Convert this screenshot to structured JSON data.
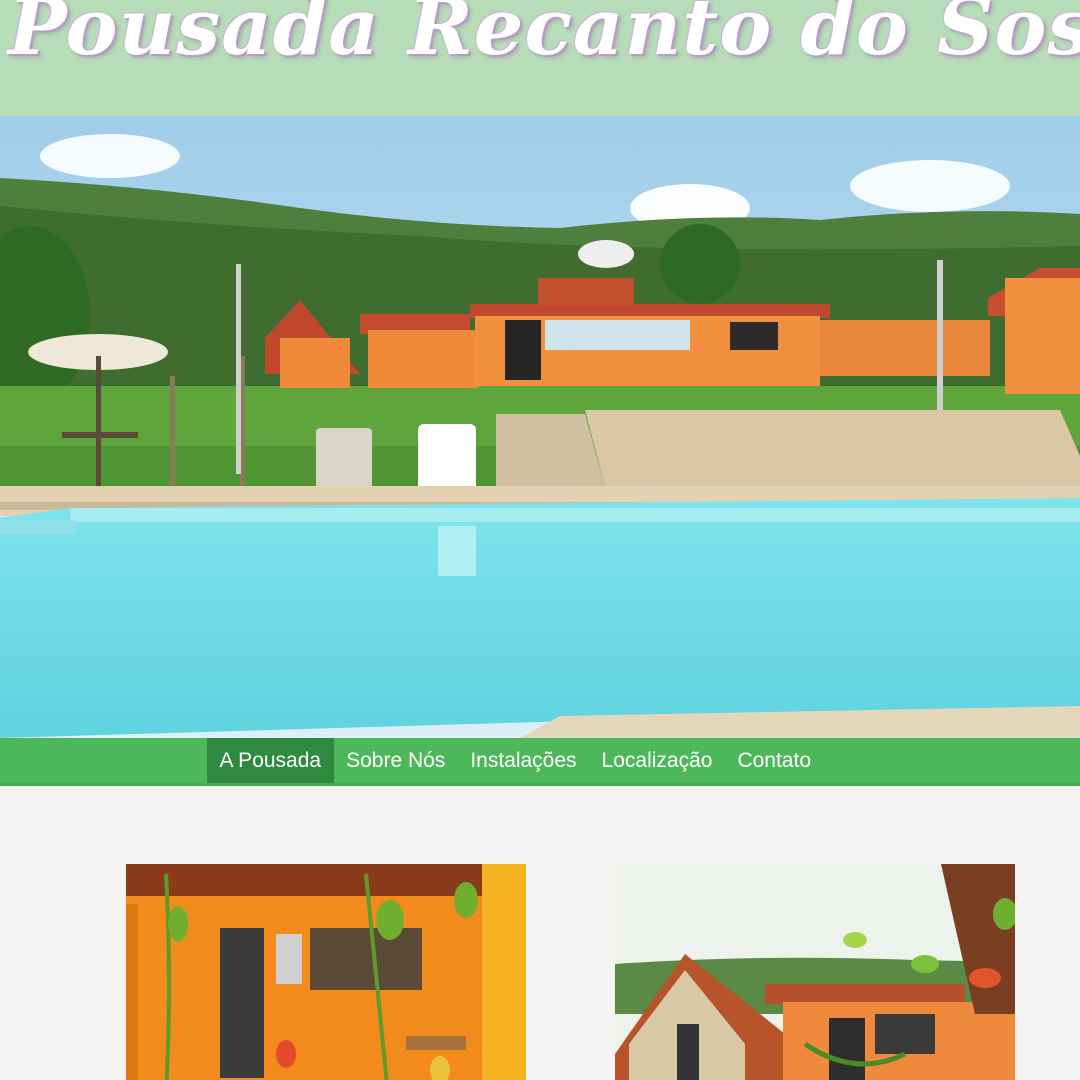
{
  "site": {
    "title": "Pousada Recanto do Sossego"
  },
  "nav": {
    "items": [
      {
        "label": "A Pousada",
        "active": true
      },
      {
        "label": "Sobre Nós",
        "active": false
      },
      {
        "label": "Instalações",
        "active": false
      },
      {
        "label": "Localização",
        "active": false
      },
      {
        "label": "Contato",
        "active": false
      }
    ]
  },
  "colors": {
    "header_bg": "#b7ddb8",
    "nav_bg": "#4cb85a",
    "nav_active_bg": "#2f8a41",
    "page_bg": "#f5f4f2",
    "pool": "#6fdde6"
  }
}
